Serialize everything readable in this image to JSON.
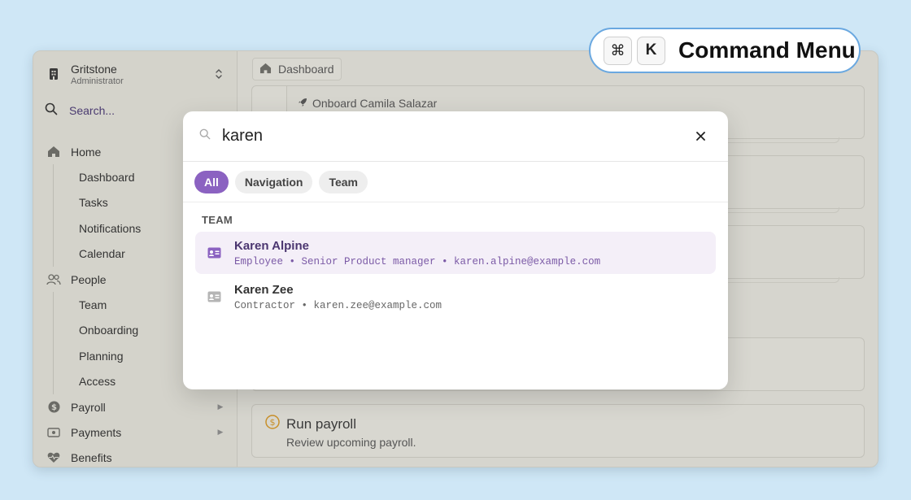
{
  "sidebar": {
    "org_name": "Gritstone",
    "org_role": "Administrator",
    "search_label": "Search...",
    "nav": {
      "home": "Home",
      "dashboard": "Dashboard",
      "tasks": "Tasks",
      "notifications": "Notifications",
      "calendar": "Calendar",
      "people": "People",
      "team": "Team",
      "onboarding": "Onboarding",
      "planning": "Planning",
      "access": "Access",
      "payroll": "Payroll",
      "payments": "Payments",
      "benefits": "Benefits"
    }
  },
  "main": {
    "breadcrumb": "Dashboard",
    "onboard_task": "Onboard Camila Salazar",
    "payroll_title": "Run payroll",
    "payroll_desc": "Review upcoming payroll."
  },
  "command_menu": {
    "query": "karen",
    "filters": [
      "All",
      "Navigation",
      "Team"
    ],
    "active_filter": "All",
    "section": "TEAM",
    "results": [
      {
        "name": "Karen Alpine",
        "meta": "Employee • Senior Product manager • karen.alpine@example.com"
      },
      {
        "name": "Karen Zee",
        "meta": "Contractor • karen.zee@example.com"
      }
    ]
  },
  "shortcut": {
    "key1": "⌘",
    "key2": "K",
    "title": "Command Menu"
  },
  "colors": {
    "accent": "#8b62c1",
    "background": "#cfe7f6",
    "badge_border": "#6aa8e0",
    "payroll_icon": "#c8902a"
  }
}
